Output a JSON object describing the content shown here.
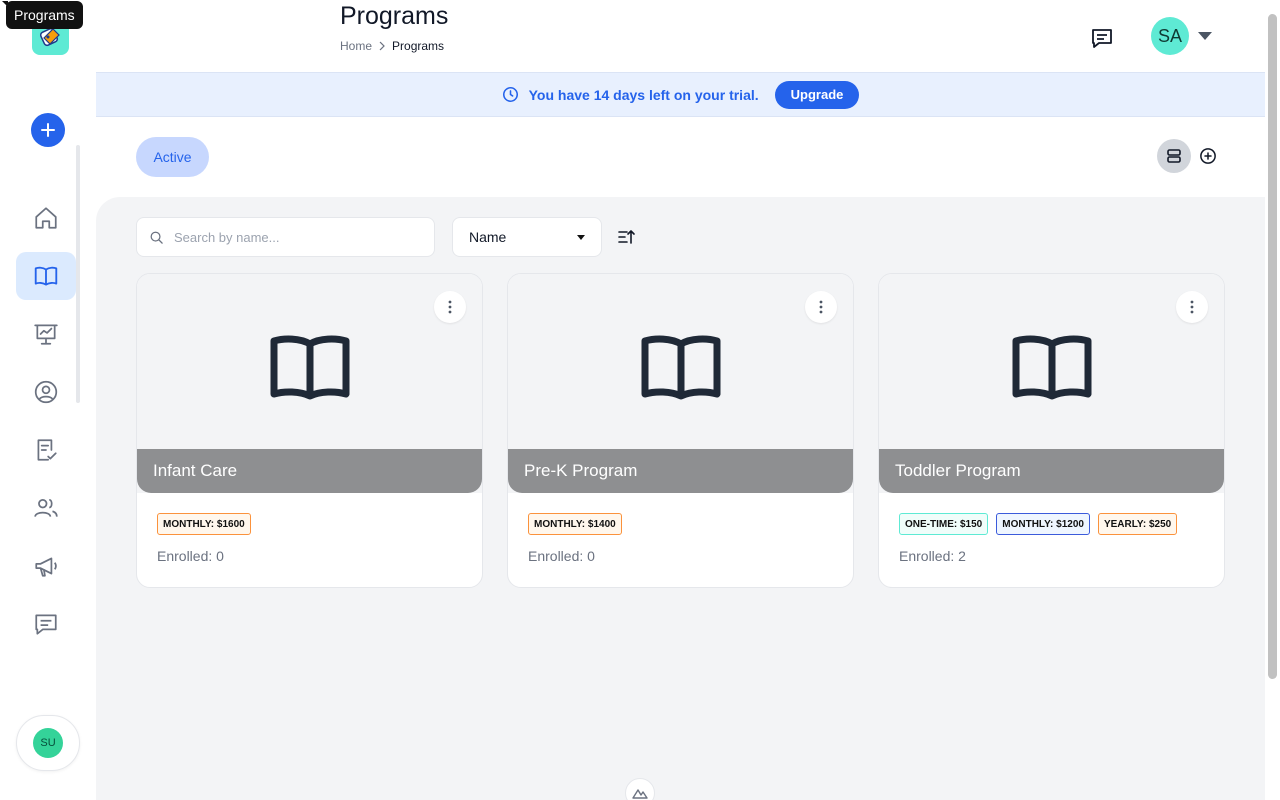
{
  "tooltip": "Programs",
  "header": {
    "title": "Programs",
    "breadcrumb": [
      "Home",
      "Programs"
    ],
    "avatar_initials": "SA"
  },
  "banner": {
    "text": "You have 14 days left on your trial.",
    "upgrade_label": "Upgrade"
  },
  "tabs": {
    "active_label": "Active"
  },
  "toolbar": {
    "search_placeholder": "Search by name...",
    "sort_value": "Name"
  },
  "sidebar": {
    "items": [
      {
        "name": "home",
        "icon": "home-icon"
      },
      {
        "name": "programs",
        "icon": "book-icon",
        "active": true
      },
      {
        "name": "reports",
        "icon": "presentation-chart-icon"
      },
      {
        "name": "profile",
        "icon": "user-circle-icon"
      },
      {
        "name": "tasks",
        "icon": "clipboard-check-icon"
      },
      {
        "name": "users",
        "icon": "users-icon"
      },
      {
        "name": "announcements",
        "icon": "megaphone-icon"
      },
      {
        "name": "messages",
        "icon": "chat-icon"
      }
    ],
    "user_initials": "SU"
  },
  "programs": [
    {
      "title": "Infant Care",
      "badges": [
        {
          "label": "MONTHLY: $1600",
          "color": "orange"
        }
      ],
      "enrolled": "Enrolled: 0"
    },
    {
      "title": "Pre-K Program",
      "badges": [
        {
          "label": "MONTHLY: $1400",
          "color": "orange"
        }
      ],
      "enrolled": "Enrolled: 0"
    },
    {
      "title": "Toddler Program",
      "badges": [
        {
          "label": "ONE-TIME: $150",
          "color": "teal"
        },
        {
          "label": "MONTHLY: $1200",
          "color": "blue"
        },
        {
          "label": "YEARLY: $250",
          "color": "orange"
        }
      ],
      "enrolled": "Enrolled: 2"
    }
  ],
  "colors": {
    "accent": "#2563eb",
    "banner_bg": "#e8f0fe",
    "card_title_bar": "#8e8f91",
    "avatar": "#5eead4"
  }
}
